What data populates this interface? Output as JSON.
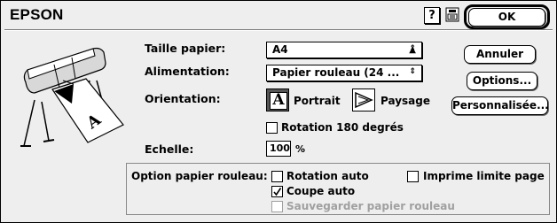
{
  "header": {
    "brand": "EPSON",
    "help_label": "?",
    "info_icon": "printer-settings-icon"
  },
  "buttons": {
    "ok": "OK",
    "cancel": "Annuler",
    "options": "Options...",
    "custom": "Personnalisée..."
  },
  "form": {
    "paper_size_label": "Taille papier:",
    "paper_size_value": "A4",
    "feed_label": "Alimentation:",
    "feed_value": "Papier rouleau (24 ...",
    "orientation_label": "Orientation:",
    "portrait_label": "Portrait",
    "landscape_label": "Paysage",
    "orientation_selected": "Portrait",
    "rotate180_label": "Rotation 180 degrés",
    "rotate180_checked": false,
    "scale_label": "Echelle:",
    "scale_value": "100",
    "scale_unit": "%"
  },
  "roll_options": {
    "label": "Option papier rouleau:",
    "auto_rotate_label": "Rotation auto",
    "auto_rotate_checked": false,
    "print_page_frame_label": "Imprime limite page",
    "print_page_frame_checked": false,
    "auto_cut_label": "Coupe auto",
    "auto_cut_checked": true,
    "save_roll_paper_label": "Sauvegarder papier rouleau",
    "save_roll_paper_checked": false,
    "save_roll_paper_enabled": false
  },
  "preview": {
    "icon": "large-format-printer-icon",
    "paper_glyph": "A"
  },
  "colors": {
    "dialog_bg": "#eeeeee",
    "disabled_text": "#a0a0a0"
  }
}
